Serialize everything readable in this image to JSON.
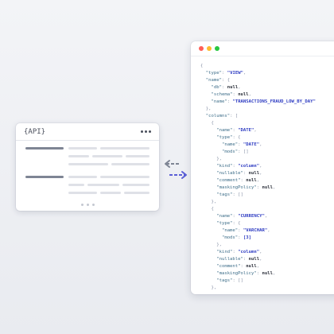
{
  "api_card": {
    "title": "{API}"
  },
  "json_window": {
    "traffic_lights": [
      "#ff5f57",
      "#febc2e",
      "#28c840"
    ],
    "lines": [
      [
        [
          "p",
          "{"
        ]
      ],
      [
        [
          "p",
          "  "
        ],
        [
          "k",
          "\"type\""
        ],
        [
          "p",
          ": "
        ],
        [
          "s",
          "\"VIEW\""
        ],
        [
          "p",
          ","
        ]
      ],
      [
        [
          "p",
          "  "
        ],
        [
          "k",
          "\"name\""
        ],
        [
          "p",
          ": {"
        ]
      ],
      [
        [
          "p",
          "    "
        ],
        [
          "k",
          "\"db\""
        ],
        [
          "p",
          ": "
        ],
        [
          "n",
          "null"
        ],
        [
          "p",
          ","
        ]
      ],
      [
        [
          "p",
          "    "
        ],
        [
          "k",
          "\"schema\""
        ],
        [
          "p",
          ": "
        ],
        [
          "n",
          "null"
        ],
        [
          "p",
          ","
        ]
      ],
      [
        [
          "p",
          "    "
        ],
        [
          "k",
          "\"name\""
        ],
        [
          "p",
          ": "
        ],
        [
          "s",
          "\"TRANSACTIONS_FRAUD_LOW_BY_DAY\""
        ]
      ],
      [
        [
          "p",
          "  },"
        ]
      ],
      [
        [
          "p",
          "  "
        ],
        [
          "k",
          "\"columns\""
        ],
        [
          "p",
          ": ["
        ]
      ],
      [
        [
          "p",
          "    {"
        ]
      ],
      [
        [
          "p",
          "      "
        ],
        [
          "k",
          "\"name\""
        ],
        [
          "p",
          ": "
        ],
        [
          "s",
          "\"DATE\""
        ],
        [
          "p",
          ","
        ]
      ],
      [
        [
          "p",
          "      "
        ],
        [
          "k",
          "\"type\""
        ],
        [
          "p",
          ": {"
        ]
      ],
      [
        [
          "p",
          "        "
        ],
        [
          "k",
          "\"name\""
        ],
        [
          "p",
          ": "
        ],
        [
          "s",
          "\"DATE\""
        ],
        [
          "p",
          ","
        ]
      ],
      [
        [
          "p",
          "        "
        ],
        [
          "k",
          "\"mods\""
        ],
        [
          "p",
          ": []"
        ]
      ],
      [
        [
          "p",
          "      },"
        ]
      ],
      [
        [
          "p",
          "      "
        ],
        [
          "k",
          "\"kind\""
        ],
        [
          "p",
          ": "
        ],
        [
          "s",
          "\"column\""
        ],
        [
          "p",
          ","
        ]
      ],
      [
        [
          "p",
          "      "
        ],
        [
          "k",
          "\"nullable\""
        ],
        [
          "p",
          ": "
        ],
        [
          "n",
          "null"
        ],
        [
          "p",
          ","
        ]
      ],
      [
        [
          "p",
          "      "
        ],
        [
          "k",
          "\"comment\""
        ],
        [
          "p",
          ": "
        ],
        [
          "n",
          "null"
        ],
        [
          "p",
          ","
        ]
      ],
      [
        [
          "p",
          "      "
        ],
        [
          "k",
          "\"maskingPolicy\""
        ],
        [
          "p",
          ": "
        ],
        [
          "n",
          "null"
        ],
        [
          "p",
          ","
        ]
      ],
      [
        [
          "p",
          "      "
        ],
        [
          "k",
          "\"tags\""
        ],
        [
          "p",
          ": []"
        ]
      ],
      [
        [
          "p",
          "    },"
        ]
      ],
      [
        [
          "p",
          "    {"
        ]
      ],
      [
        [
          "p",
          "      "
        ],
        [
          "k",
          "\"name\""
        ],
        [
          "p",
          ": "
        ],
        [
          "s",
          "\"CURRENCY\""
        ],
        [
          "p",
          ","
        ]
      ],
      [
        [
          "p",
          "      "
        ],
        [
          "k",
          "\"type\""
        ],
        [
          "p",
          ": {"
        ]
      ],
      [
        [
          "p",
          "        "
        ],
        [
          "k",
          "\"name\""
        ],
        [
          "p",
          ": "
        ],
        [
          "s",
          "\"VARCHAR\""
        ],
        [
          "p",
          ","
        ]
      ],
      [
        [
          "p",
          "        "
        ],
        [
          "k",
          "\"mods\""
        ],
        [
          "p",
          ": "
        ],
        [
          "s",
          "[3]"
        ]
      ],
      [
        [
          "p",
          "      },"
        ]
      ],
      [
        [
          "p",
          "      "
        ],
        [
          "k",
          "\"kind\""
        ],
        [
          "p",
          ": "
        ],
        [
          "s",
          "\"column\""
        ],
        [
          "p",
          ","
        ]
      ],
      [
        [
          "p",
          "      "
        ],
        [
          "k",
          "\"nullable\""
        ],
        [
          "p",
          ": "
        ],
        [
          "n",
          "null"
        ],
        [
          "p",
          ","
        ]
      ],
      [
        [
          "p",
          "      "
        ],
        [
          "k",
          "\"comment\""
        ],
        [
          "p",
          ": "
        ],
        [
          "n",
          "null"
        ],
        [
          "p",
          ","
        ]
      ],
      [
        [
          "p",
          "      "
        ],
        [
          "k",
          "\"maskingPolicy\""
        ],
        [
          "p",
          ": "
        ],
        [
          "n",
          "null"
        ],
        [
          "p",
          ","
        ]
      ],
      [
        [
          "p",
          "      "
        ],
        [
          "k",
          "\"tags\""
        ],
        [
          "p",
          ": []"
        ]
      ],
      [
        [
          "p",
          "    },"
        ]
      ]
    ]
  },
  "arrows": {
    "left_arrow_color": "#7e8594",
    "right_arrow_color": "#5b5fd6"
  },
  "icons": {
    "more": "more-horizontal-icon",
    "left_arrow": "dashed-arrow-left-icon",
    "right_arrow": "dashed-arrow-right-icon"
  }
}
